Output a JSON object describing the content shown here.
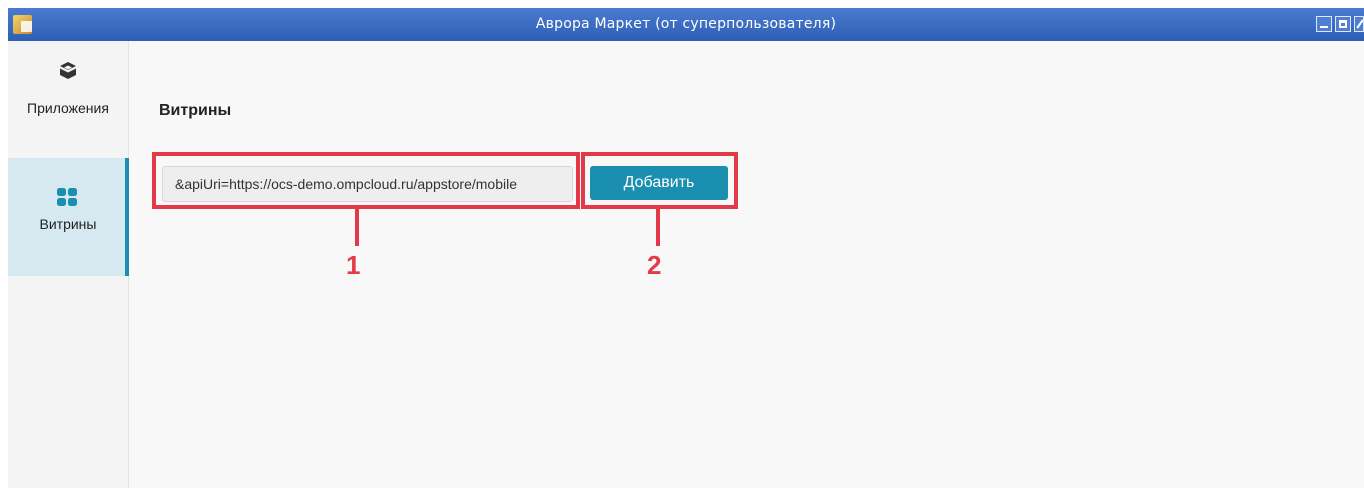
{
  "window": {
    "title": "Аврора Маркет (от суперпользователя)",
    "icon": "app-icon"
  },
  "sidebar": {
    "items": [
      {
        "label": "Приложения",
        "icon": "box-icon",
        "selected": false
      },
      {
        "label": "Витрины",
        "icon": "grid-icon",
        "selected": true
      }
    ]
  },
  "main": {
    "title": "Витрины",
    "store_input": {
      "value": "&apiUri=https://ocs-demo.ompcloud.ru/appstore/mobile",
      "placeholder": ""
    },
    "add_button_label": "Добавить"
  },
  "annotations": {
    "callout_1": "1",
    "callout_2": "2"
  },
  "colors": {
    "accent": "#1a8fb0",
    "selected_bg": "#d6e9f0",
    "highlight": "#e33a49",
    "titlebar": "#3a6cc6"
  }
}
